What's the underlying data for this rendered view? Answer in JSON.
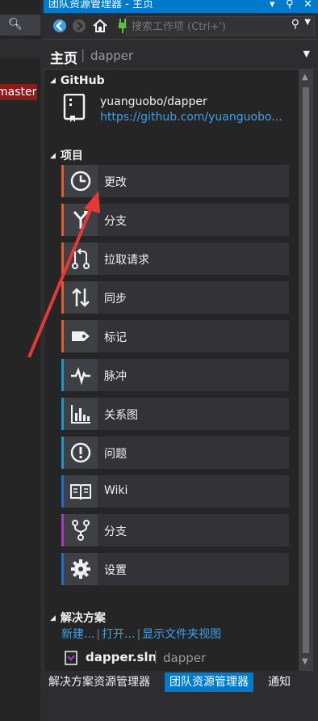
{
  "window": {
    "title": "团队资源管理器 - 主页",
    "pin_icon": "pin-icon",
    "close_icon": "close-icon"
  },
  "left_pane": {
    "branch_text": "master",
    "search_icon": "search-icon"
  },
  "toolbar": {
    "back_icon": "back-arrow-icon",
    "forward_icon": "forward-arrow-icon",
    "home_icon": "home-icon",
    "connect_icon": "plug-icon",
    "refresh_icon": "refresh-icon",
    "search_placeholder": "搜索工作项 (Ctrl+')"
  },
  "page_header": {
    "title": "主页",
    "separator": "|",
    "repo": "dapper"
  },
  "github": {
    "heading": "GitHub",
    "repo_name": "yuanguobo/dapper",
    "repo_url": "https://github.com/yuanguobo..."
  },
  "project": {
    "heading": "项目",
    "items": [
      {
        "label": "更改",
        "icon": "clock-icon",
        "color": "#e05d2f"
      },
      {
        "label": "分支",
        "icon": "branch-icon",
        "color": "#e05d2f"
      },
      {
        "label": "拉取请求",
        "icon": "pull-request-icon",
        "color": "#e05d2f"
      },
      {
        "label": "同步",
        "icon": "sync-arrows-icon",
        "color": "#e05d2f"
      },
      {
        "label": "标记",
        "icon": "tag-icon",
        "color": "#e05d2f"
      },
      {
        "label": "脉冲",
        "icon": "pulse-icon",
        "color": "#1c97c4"
      },
      {
        "label": "关系图",
        "icon": "bar-chart-icon",
        "color": "#1c97c4"
      },
      {
        "label": "问题",
        "icon": "exclamation-icon",
        "color": "#1c97c4"
      },
      {
        "label": "Wiki",
        "icon": "book-icon",
        "color": "#1c6fd1"
      },
      {
        "label": "分支",
        "icon": "fork-icon",
        "color": "#a83dbf"
      },
      {
        "label": "设置",
        "icon": "gear-icon",
        "color": "#1c6fd1"
      }
    ]
  },
  "solutions": {
    "heading": "解决方案",
    "new_link": "新建...",
    "open_link": "打开...",
    "show_folder_link": "显示文件夹视图",
    "link_separator": "|",
    "file_name": "dapper.sln",
    "file_separator": "|",
    "file_repo": "dapper"
  },
  "bottom_tabs": [
    {
      "label": "解决方案资源管理器",
      "active": false
    },
    {
      "label": "团队资源管理器",
      "active": true
    },
    {
      "label": "通知",
      "active": false
    }
  ],
  "annotation": {
    "arrow_color": "#e53935"
  }
}
